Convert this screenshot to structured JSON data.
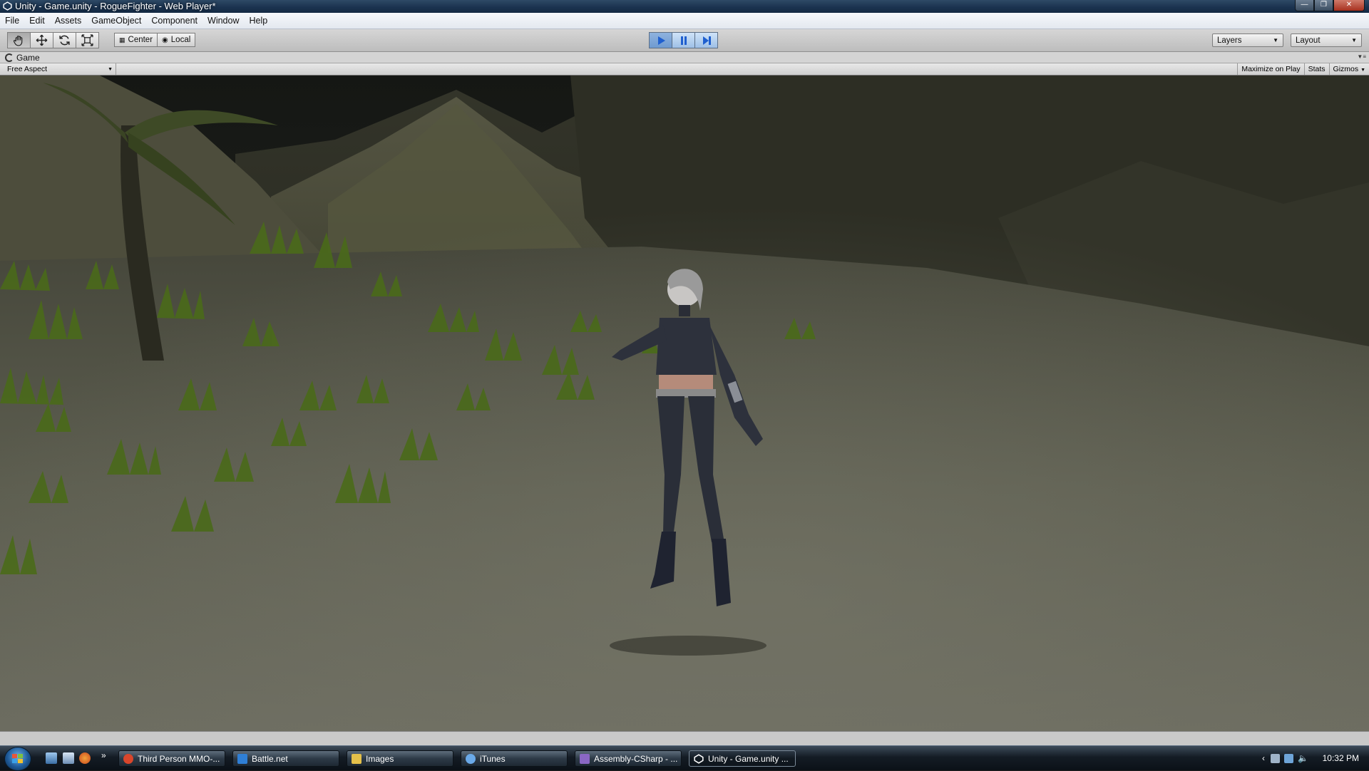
{
  "window": {
    "title": "Unity - Game.unity - RogueFighter - Web Player*",
    "buttons": [
      "minimize",
      "maximize",
      "close"
    ]
  },
  "menu": [
    "File",
    "Edit",
    "Assets",
    "GameObject",
    "Component",
    "Window",
    "Help"
  ],
  "toolbar": {
    "tools": [
      "hand-tool",
      "move-tool",
      "rotate-tool",
      "scale-tool"
    ],
    "pivot_label": "Center",
    "space_label": "Local",
    "layers_label": "Layers",
    "layout_label": "Layout"
  },
  "game_panel": {
    "tab_label": "Game",
    "aspect_label": "Free Aspect",
    "maximize_label": "Maximize on Play",
    "stats_label": "Stats",
    "gizmos_label": "Gizmos"
  },
  "taskbar": {
    "items": [
      {
        "label": "Third Person MMO-...",
        "icon_color": "#d9462b"
      },
      {
        "label": "Battle.net",
        "icon_color": "#2f7fd6"
      },
      {
        "label": "Images",
        "icon_color": "#e4c04a"
      },
      {
        "label": "iTunes",
        "icon_color": "#6aa9e8"
      },
      {
        "label": "Assembly-CSharp - ...",
        "icon_color": "#8a67c4"
      },
      {
        "label": "Unity - Game.unity ...",
        "icon_color": "#e8e8e8",
        "active": true
      }
    ],
    "clock": "10:32 PM"
  },
  "colors": {
    "play_active": "#3a7bd5",
    "titlebar": "#1b3350",
    "terrain": "#5a5a48",
    "grass": "#4c6a1c"
  }
}
